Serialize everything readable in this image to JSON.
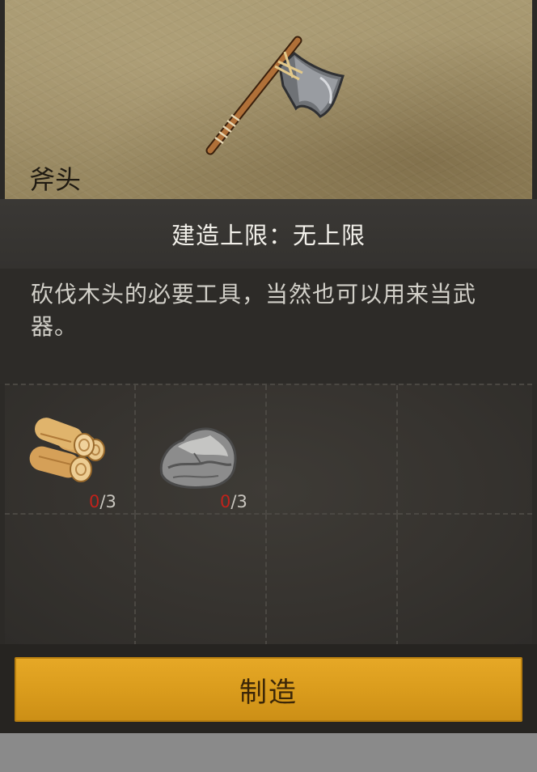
{
  "item": {
    "name": "斧头",
    "icon": "axe-icon"
  },
  "build_limit": {
    "text": "建造上限：无上限"
  },
  "description": {
    "text": "砍伐木头的必要工具，当然也可以用来当武器。"
  },
  "materials": [
    {
      "icon": "wood-logs-icon",
      "have": "0",
      "need": "/3"
    },
    {
      "icon": "stone-icon",
      "have": "0",
      "need": "/3"
    }
  ],
  "craft_button": {
    "label": "制造"
  },
  "colors": {
    "accent": "#d99b1c",
    "count_missing": "#c1221b"
  }
}
